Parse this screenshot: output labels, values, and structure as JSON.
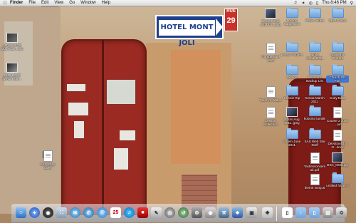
{
  "menubar": {
    "apple_icon": "apple-icon",
    "items": [
      "Finder",
      "File",
      "Edit",
      "View",
      "Go",
      "Window",
      "Help"
    ],
    "clock": "Thu 8:46 PM"
  },
  "wallpaper": {
    "sign_text": "HOTEL MONT JOLI",
    "rue_label": "RUE",
    "rue_number": "29"
  },
  "desktop_icons_left": [
    {
      "label": "LOVE WINS Mdb Ruth...doc"
    },
    {
      "label": "2012 LOVE WINS Ruth..."
    },
    {
      "label": "SAS Ebay Sales"
    }
  ],
  "desktop_icons": [
    {
      "label": "Screen Shot 2011-03...png",
      "kind": "img"
    },
    {
      "label": "Lesson Suggestion",
      "kind": "folder"
    },
    {
      "label": "Wilbur Video",
      "kind": "folder"
    },
    {
      "label": "Spirit Faces",
      "kind": "folder"
    },
    {
      "label": "Garage Sale Stuff",
      "kind": "doc"
    },
    {
      "label": "Lesson Stories",
      "kind": "folder"
    },
    {
      "label": "Ignite Kona..2011",
      "kind": "folder"
    },
    {
      "label": "Academic Phones",
      "kind": "folder"
    },
    {
      "label": "Videos",
      "kind": "folder"
    },
    {
      "label": "Keenan's Backup List",
      "kind": "folder"
    },
    {
      "label": "Church GR Fun",
      "kind": "folder",
      "selected": true
    },
    {
      "label": "Twist for Wilbur",
      "kind": "doc"
    },
    {
      "label": "Keenie Rip",
      "kind": "folder"
    },
    {
      "label": "Kenoa March 2011",
      "kind": "folder"
    },
    {
      "label": "Cody Edits",
      "kind": "folder"
    },
    {
      "label": "Lesson Reflection",
      "kind": "doc"
    },
    {
      "label": "Photo Aug 2011..jpeg",
      "kind": "img"
    },
    {
      "label": "kokomo tumblr",
      "kind": "folder"
    },
    {
      "label": "Course 2 June ... pdf",
      "kind": "doc"
    },
    {
      "label": "Salem June 2011",
      "kind": "folder"
    },
    {
      "label": "SAS Web Site Stuff",
      "kind": "folder"
    },
    {
      "label": "Devotions for O...docx",
      "kind": "doc"
    },
    {
      "label": "Taxtlessonsemail.pdf",
      "kind": "doc"
    },
    {
      "label": "DSC_0036.jpg",
      "kind": "img"
    },
    {
      "label": "theme song.ai",
      "kind": "doc"
    },
    {
      "label": "untitled folder 2",
      "kind": "folder"
    }
  ],
  "dock": {
    "items": [
      "Finder",
      "Safari",
      "Dashboard",
      "Preview",
      "Mail",
      "iChat",
      "Address Book",
      "Calendar",
      "iTunes",
      "Photo Booth",
      "Clock",
      "System Preferences",
      "Downloads",
      "Documents",
      "Trash"
    ],
    "calendar_day": "25"
  }
}
